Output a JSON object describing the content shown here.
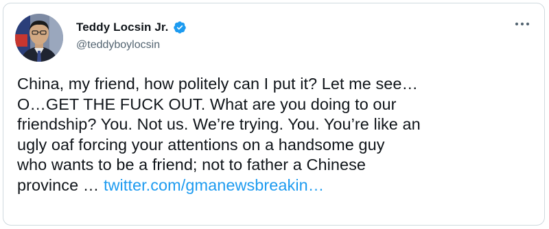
{
  "author": {
    "display_name": "Teddy Locsin Jr.",
    "handle": "@teddyboylocsin",
    "verified": true,
    "avatar_icon": "profile-photo"
  },
  "more_icon": "more-horizontal-icon",
  "tweet": {
    "body": "China, my friend, how politely can I put it? Let me see…\nO…GET THE FUCK OUT. What are you doing to our\nfriendship? You. Not us. We’re trying. You. You’re like an\nugly oaf forcing your attentions on a handsome guy\nwho wants to be a friend; not to father a Chinese\nprovince … ",
    "link_text": "twitter.com/gmanewsbreakin…"
  },
  "colors": {
    "text": "#0f1419",
    "secondary": "#536471",
    "link": "#1d9bf0",
    "verified": "#1d9bf0",
    "border": "#cfd9de"
  }
}
